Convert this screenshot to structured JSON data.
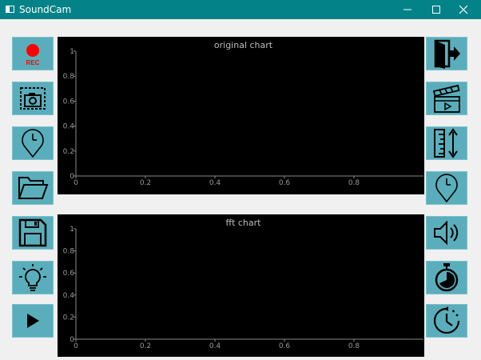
{
  "window": {
    "title": "SoundCam",
    "controls": [
      "minimize",
      "maximize",
      "close"
    ]
  },
  "left_toolbar": [
    {
      "icon": "record-icon",
      "label": "REC"
    },
    {
      "icon": "screenshot-camera-icon"
    },
    {
      "icon": "timer-pin-icon"
    },
    {
      "icon": "folder-icon"
    },
    {
      "icon": "save-icon"
    },
    {
      "icon": "lightbulb-icon"
    },
    {
      "icon": "play-icon"
    }
  ],
  "right_toolbar": [
    {
      "icon": "exit-icon"
    },
    {
      "icon": "clapperboard-icon"
    },
    {
      "icon": "ruler-scale-icon"
    },
    {
      "icon": "timer-pin-icon"
    },
    {
      "icon": "speaker-icon"
    },
    {
      "icon": "stopwatch-icon"
    },
    {
      "icon": "clock-refresh-icon"
    }
  ],
  "colors": {
    "titlebar": "#038387",
    "button_fill": "#5aaebb",
    "chart_background": "#000000",
    "rec_red": "#ff0000"
  },
  "chart_data": [
    {
      "type": "line",
      "title": "original chart",
      "xlabel": "",
      "ylabel": "",
      "xlim": [
        0,
        1
      ],
      "ylim": [
        0,
        1
      ],
      "xticks": [
        "0",
        "0.2",
        "0.4",
        "0.6",
        "0.8"
      ],
      "yticks": [
        "0",
        "0.2",
        "0.4",
        "0.6",
        "0.8",
        "1"
      ],
      "series": [],
      "grid": false
    },
    {
      "type": "line",
      "title": "fft chart",
      "xlabel": "",
      "ylabel": "",
      "xlim": [
        0,
        1
      ],
      "ylim": [
        0,
        1
      ],
      "xticks": [
        "0",
        "0.2",
        "0.4",
        "0.6",
        "0.8"
      ],
      "yticks": [
        "0",
        "0.2",
        "0.4",
        "0.6",
        "0.8",
        "1"
      ],
      "series": [],
      "grid": false
    }
  ]
}
